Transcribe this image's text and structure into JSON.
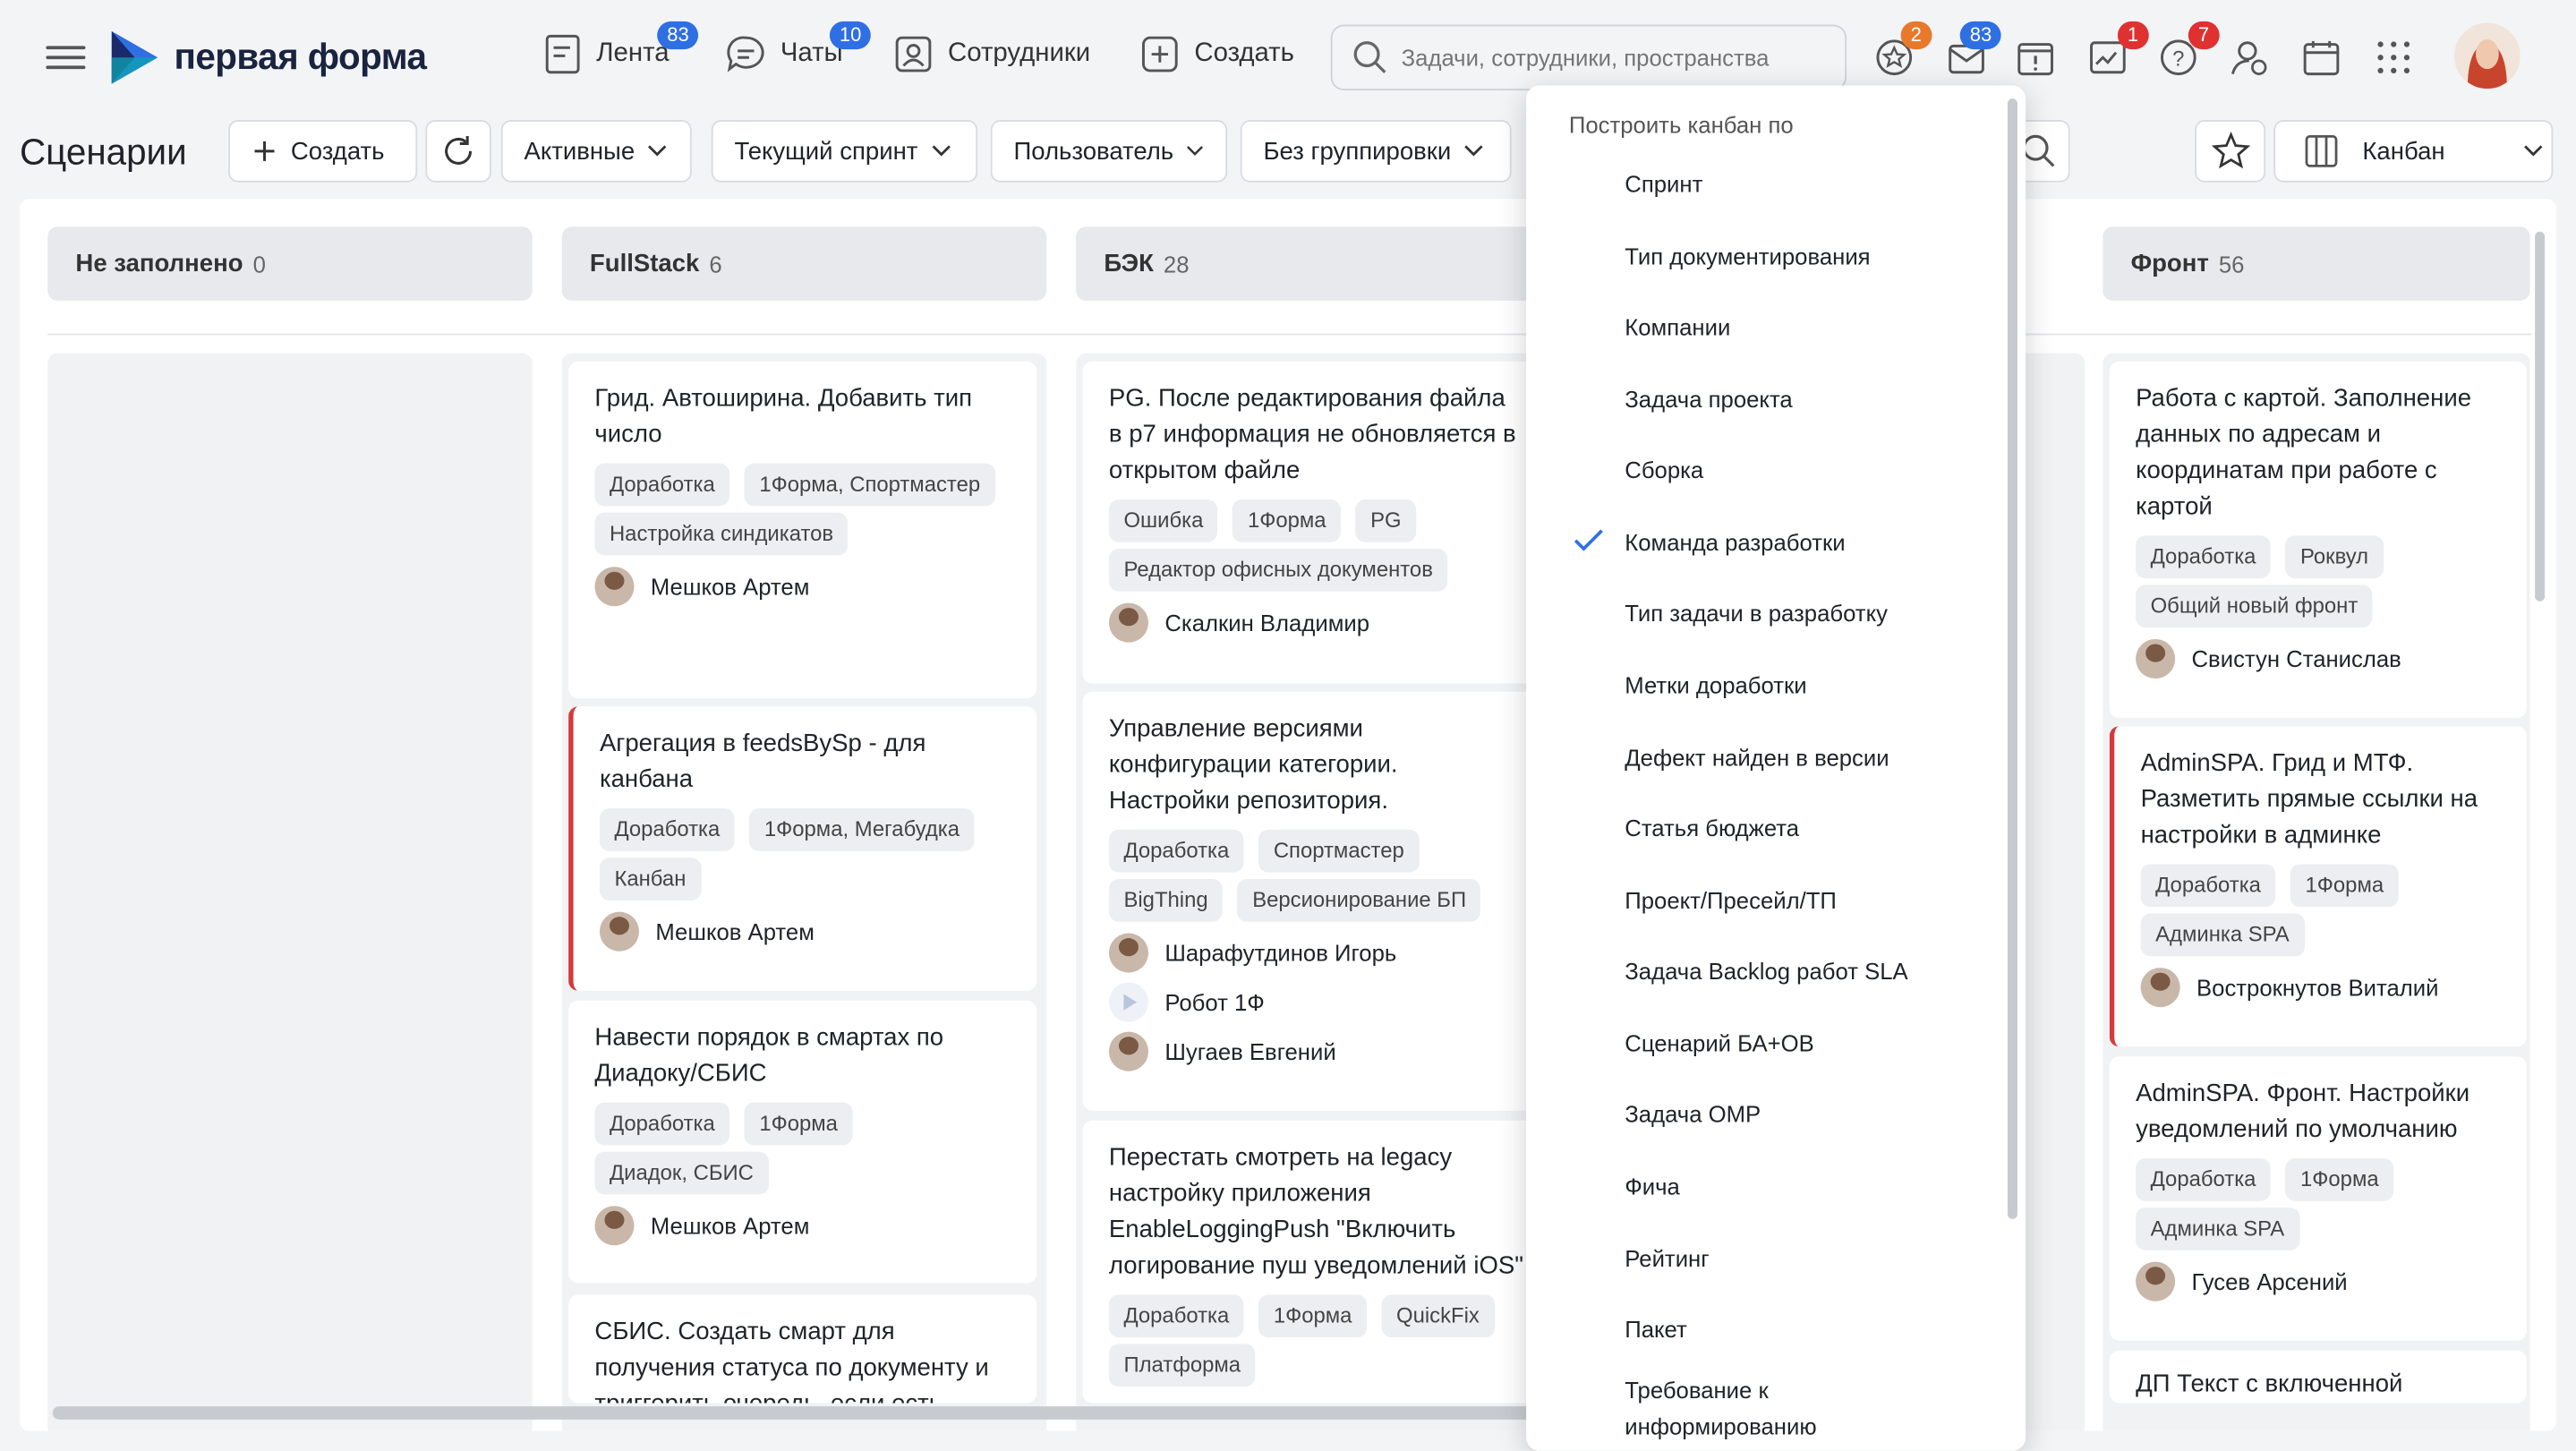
{
  "brand": {
    "name": "первая форма",
    "accent": "#2f6fe4"
  },
  "nav": {
    "feed": {
      "label": "Лента",
      "badge": "83"
    },
    "chats": {
      "label": "Чаты",
      "badge": "10"
    },
    "employees": {
      "label": "Сотрудники"
    },
    "create": {
      "label": "Создать"
    }
  },
  "search": {
    "placeholder": "Задачи, сотрудники, пространства"
  },
  "header_icons": [
    {
      "name": "favorites-icon",
      "badge": "2"
    },
    {
      "name": "mail-icon",
      "badge": "83"
    },
    {
      "name": "alert-icon",
      "badge": ""
    },
    {
      "name": "reports-icon",
      "badge": "1"
    },
    {
      "name": "help-icon",
      "badge": "7"
    },
    {
      "name": "user-settings-icon",
      "badge": ""
    },
    {
      "name": "calendar-icon",
      "badge": ""
    },
    {
      "name": "apps-grid-icon",
      "badge": ""
    }
  ],
  "toolbar": {
    "title": "Сценарии",
    "create_label": "Создать",
    "filter_active": "Активные",
    "filter_sprint": "Текущий спринт",
    "filter_user": "Пользователь",
    "grouping": "Без группировки",
    "view": "Канбан"
  },
  "columns": [
    {
      "title": "Не заполнено",
      "count": "0"
    },
    {
      "title": "FullStack",
      "count": "6"
    },
    {
      "title": "БЭК",
      "count": "28"
    },
    {
      "title": "Фронт",
      "count": "56"
    }
  ],
  "cards": {
    "fullstack": [
      {
        "title": "Грид. Автоширина. Добавить тип число",
        "tags": [
          "Доработка",
          "1Форма, Спортмастер",
          "Настройка синдикатов"
        ],
        "assignees": [
          "Мешков Артем"
        ]
      },
      {
        "title": "Агрегация в feedsBySp - для канбана",
        "tags": [
          "Доработка",
          "1Форма, Мегабудка",
          "Канбан"
        ],
        "assignees": [
          "Мешков Артем"
        ]
      },
      {
        "title": "Навести порядок в смартах по Диадоку/СБИС",
        "tags": [
          "Доработка",
          "1Форма",
          "Диадок, СБИС"
        ],
        "assignees": [
          "Мешков Артем"
        ]
      },
      {
        "title": "СБИС. Создать смарт для получения статуса по документу и триггерить очередь, если есть",
        "tags": [],
        "assignees": []
      }
    ],
    "back": [
      {
        "title": "PG. После редактирования файла в р7 информация не обновляется в открытом файле",
        "tags": [
          "Ошибка",
          "1Форма",
          "PG",
          "Редактор офисных документов"
        ],
        "assignees": [
          "Скалкин Владимир"
        ]
      },
      {
        "title": "Управление версиями конфигурации категории. Настройки репозитория.",
        "tags": [
          "Доработка",
          "Спортмастер",
          "BigThing",
          "Версионирование БП"
        ],
        "assignees": [
          "Шарафутдинов Игорь",
          "Робот 1Ф",
          "Шугаев Евгений"
        ]
      },
      {
        "title": "Перестать смотреть на legacy настройку приложения EnableLoggingPush \"Включить логирование пуш уведомлений iOS\"",
        "tags": [
          "Доработка",
          "1Форма",
          "QuickFix",
          "Платформа"
        ],
        "assignees": []
      }
    ],
    "front": [
      {
        "title": "Работа с картой. Заполнение данных по адресам и координатам при работе с картой",
        "tags": [
          "Доработка",
          "Роквул",
          "Общий новый фронт"
        ],
        "assignees": [
          "Свистун Станислав"
        ]
      },
      {
        "title": "AdminSPA. Грид и МТФ. Разметить прямые ссылки на настройки в админке",
        "tags": [
          "Доработка",
          "1Форма",
          "Админка SPA"
        ],
        "assignees": [
          "Вострокнутов Виталий"
        ]
      },
      {
        "title": "AdminSPA. Фронт. Настройки уведомлений по умолчанию",
        "tags": [
          "Доработка",
          "1Форма",
          "Админка SPA"
        ],
        "assignees": [
          "Гусев Арсений"
        ]
      },
      {
        "title": "ДП Текст с включенной",
        "tags": [],
        "assignees": []
      }
    ]
  },
  "dropdown": {
    "title": "Построить канбан по",
    "selected": "Команда разработки",
    "items": [
      "Спринт",
      "Тип документирования",
      "Компании",
      "Задача проекта",
      "Сборка",
      "Команда разработки",
      "Тип задачи в разработку",
      "Метки доработки",
      "Дефект найден в версии",
      "Статья бюджета",
      "Проект/Пресейл/ТП",
      "Задача Backlog работ SLA",
      "Сценарий БА+ОВ",
      "Задача ОМР",
      "Фича",
      "Рейтинг",
      "Пакет",
      "Требование к информированию"
    ]
  },
  "colors": {
    "flag": "#d63a3a",
    "badge": "#2f6fe4",
    "badge_red": "#e03131",
    "badge_orange": "#e8792b",
    "check": "#2f6fe4"
  }
}
